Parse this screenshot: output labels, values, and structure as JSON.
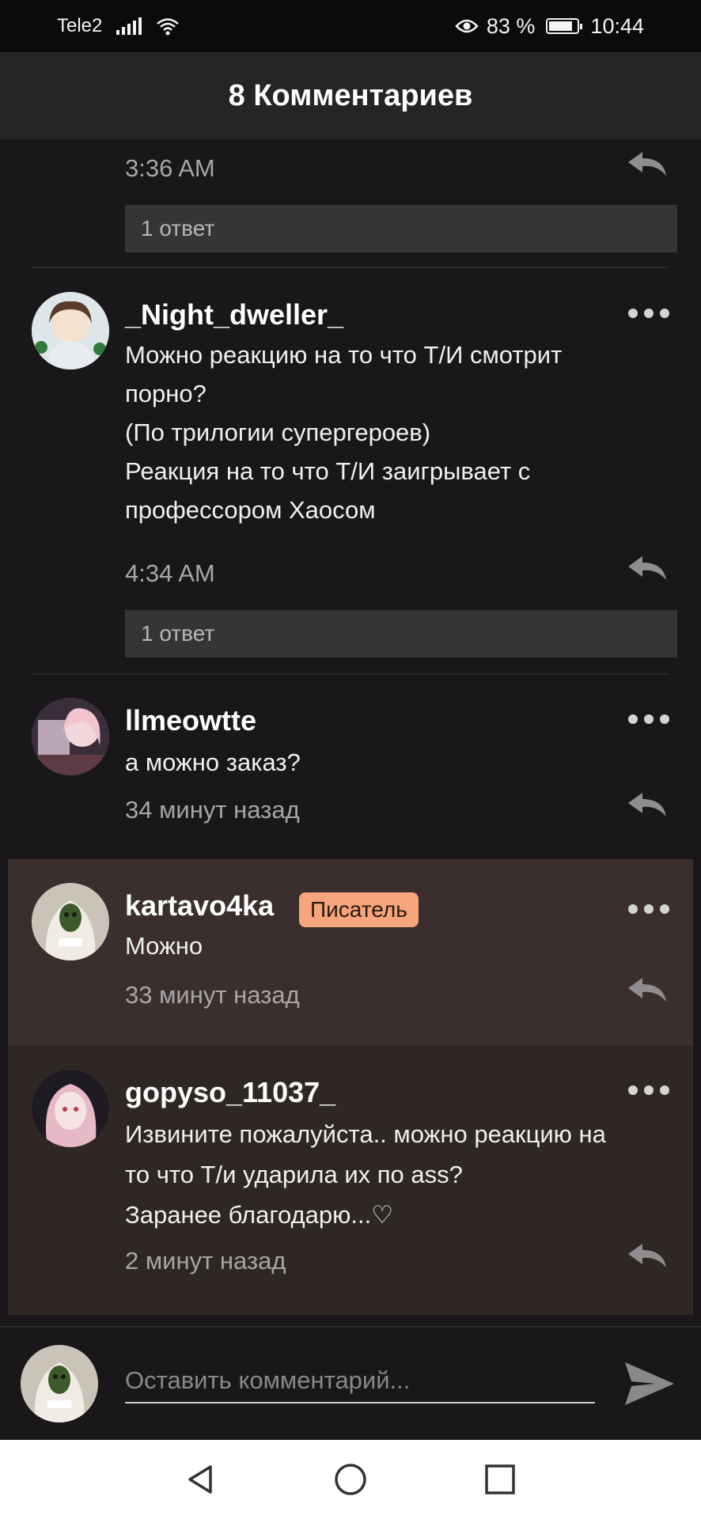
{
  "status_bar": {
    "carrier": "Tele2",
    "battery": "83 %",
    "time": "10:44",
    "battery_level": 0.83
  },
  "header": {
    "title": "8 Комментариев"
  },
  "comments": [
    {
      "time": "3:36 AM",
      "replies": "1 ответ"
    },
    {
      "username": "_Night_dweller_",
      "lines": [
        "Можно реакцию на то что Т/И смотрит",
        "порно?",
        "(По трилогии супергероев)",
        "Реакция на то что Т/И заигрывает с",
        "профессором Хаосом"
      ],
      "time": "4:34 AM",
      "replies": "1 ответ"
    },
    {
      "username": "llmeowtte",
      "lines": [
        "а можно заказ?"
      ],
      "time": "34 минут назад"
    },
    {
      "username": "kartavo4ka",
      "badge": "Писатель",
      "lines": [
        "Можно"
      ],
      "time": "33 минут назад"
    },
    {
      "username": "gopyso_11037_",
      "lines": [
        "Извините пожалуйста.. можно реакцию на",
        "то что Т/и ударила их по ass?",
        "Заранее благодарю...♡"
      ],
      "time": "2 минут назад"
    }
  ],
  "composer": {
    "placeholder": "Оставить комментарий..."
  },
  "colors": {
    "background": "#19171a",
    "highlight_reply": "#3b2f2d",
    "highlight_new": "#2f2724",
    "badge": "#f7a57c"
  },
  "icons": [
    "eye-icon",
    "wifi-icon",
    "signal-icon",
    "battery-icon",
    "more-icon",
    "reply-icon",
    "send-icon",
    "back-icon",
    "home-icon",
    "recents-icon"
  ]
}
